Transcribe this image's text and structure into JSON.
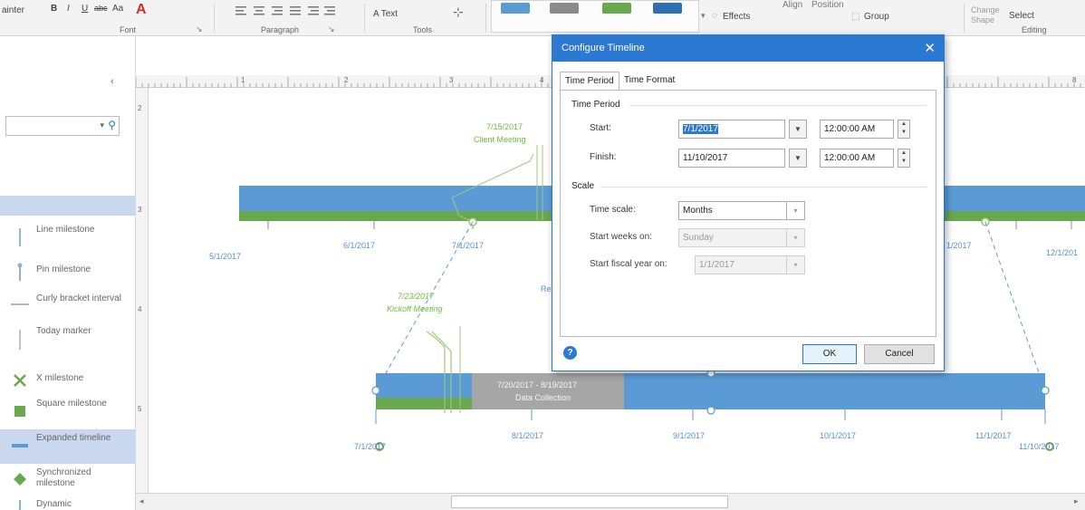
{
  "ribbon": {
    "left_cut_text": "ainter",
    "font_buttons": [
      "B",
      "I",
      "U",
      "abc",
      "Aa"
    ],
    "font_color_glyph": "A",
    "font_group": "Font",
    "paragraph_group": "Paragraph",
    "tools_group": "Tools",
    "text_button": "A Text",
    "effects_button": "Effects",
    "align_label": "Align",
    "position_label": "Position",
    "group_button": "Group",
    "change_shape_label": "Change Shape",
    "select_button": "Select",
    "editing_group": "Editing"
  },
  "shapes_pane": {
    "collapse_glyph": "‹",
    "search_dropdown_glyph": "▾",
    "items": [
      {
        "label": "Line milestone"
      },
      {
        "label": "Pin milestone"
      },
      {
        "label": "Curly bracket interval"
      },
      {
        "label": "Today marker"
      },
      {
        "label": "X milestone"
      },
      {
        "label": "Square milestone"
      },
      {
        "label": "Expanded timeline"
      },
      {
        "label": "Synchronized milestone"
      },
      {
        "label": "Dynamic"
      }
    ]
  },
  "rulers": {
    "top_numbers": [
      "1",
      "2",
      "3",
      "4",
      "8"
    ],
    "left_numbers": [
      "2",
      "3",
      "4",
      "5"
    ]
  },
  "canvas": {
    "top_timeline": {
      "date_labels": [
        "5/1/2017",
        "6/1/2017",
        "7/1/2017",
        "1/2017",
        "12/1/201"
      ],
      "milestone_date": "7/15/2017",
      "milestone_label": "Client Meeting",
      "partial_label": "Re"
    },
    "expanded_timeline": {
      "overlap_date": "7/23/2017",
      "overlap_label": "Kickoff Meeting",
      "interval_text_1": "7/20/2017 - 8/19/2017",
      "interval_text_2": "Data Collection",
      "date_labels": [
        "7/1/2017",
        "8/1/2017",
        "9/1/2017",
        "10/1/2017",
        "11/1/2017",
        "11/10/2017"
      ]
    }
  },
  "dialog": {
    "title": "Configure Timeline",
    "close_glyph": "✕",
    "tabs": [
      "Time Period",
      "Time Format"
    ],
    "time_period_group": "Time Period",
    "start_label": "Start:",
    "start_date": "7/1/2017",
    "start_time": "12:00:00 AM",
    "finish_label": "Finish:",
    "finish_date": "11/10/2017",
    "finish_time": "12:00:00 AM",
    "scale_group": "Scale",
    "time_scale_label": "Time scale:",
    "time_scale_value": "Months",
    "start_weeks_label": "Start weeks on:",
    "start_weeks_value": "Sunday",
    "start_fiscal_label": "Start fiscal year on:",
    "start_fiscal_value": "1/1/2017",
    "help_glyph": "?",
    "ok_label": "OK",
    "cancel_label": "Cancel"
  },
  "colors": {
    "timeline_blue": "#5b9bd5",
    "progress_green": "#6aa84f",
    "interval_gray": "#a6a6a6",
    "dialog_blue": "#2b79d1"
  }
}
